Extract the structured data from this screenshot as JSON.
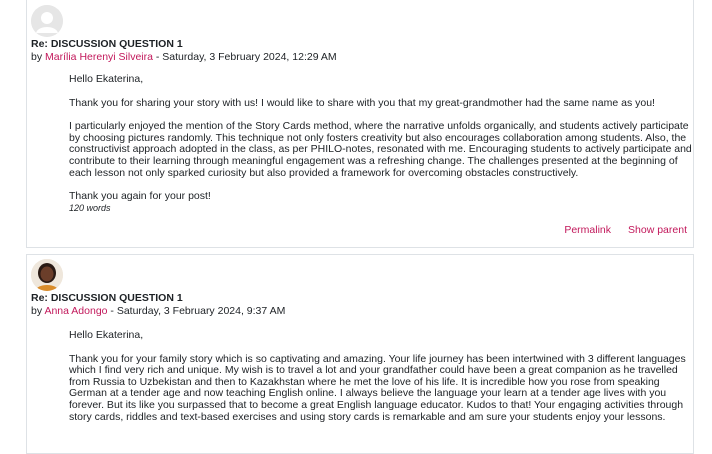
{
  "posts": [
    {
      "subject": "Re: DISCUSSION QUESTION 1",
      "by_prefix": "by ",
      "author": "Marília Herenyi Silveira",
      "date": " - Saturday, 3 February 2024, 12:29 AM",
      "paragraphs": [
        "Hello Ekaterina,",
        "Thank you for sharing your story with us! I would like to share with you that my great-grandmother had the same name as you!",
        "I particularly enjoyed the mention of the Story Cards method, where the narrative unfolds organically, and students actively participate by choosing pictures randomly. This technique not only fosters creativity but also encourages collaboration among students. Also, the constructivist approach adopted in the class, as per PHILO-notes, resonated with me. Encouraging students to actively participate and contribute to their learning through meaningful engagement was a refreshing change. The challenges presented at the beginning of each lesson not only sparked curiosity but also provided a framework for overcoming obstacles constructively.",
        "Thank you again for your post!"
      ],
      "word_count": "120 words",
      "actions": {
        "permalink": "Permalink",
        "show_parent": "Show parent"
      }
    },
    {
      "subject": "Re: DISCUSSION QUESTION 1",
      "by_prefix": "by ",
      "author": "Anna Adongo",
      "date": " - Saturday, 3 February 2024, 9:37 AM",
      "paragraphs": [
        "Hello Ekaterina,",
        "Thank you for your family story which is so captivating and amazing. Your life journey has been intertwined with 3 different languages which I find very rich and unique. My wish is to travel a lot and your grandfather could have been a great companion as he travelled from Russia to Uzbekistan and then to Kazakhstan where he met the love of his life. It is incredible how you rose from speaking German at a tender age and now teaching English online. I always believe the language your learn at a tender age lives with you forever. But its like you surpassed that to become a great English language educator. Kudos to that! Your engaging activities through story cards, riddles and text-based exercises and using story cards is remarkable and am sure your students enjoy your lessons."
      ]
    }
  ]
}
